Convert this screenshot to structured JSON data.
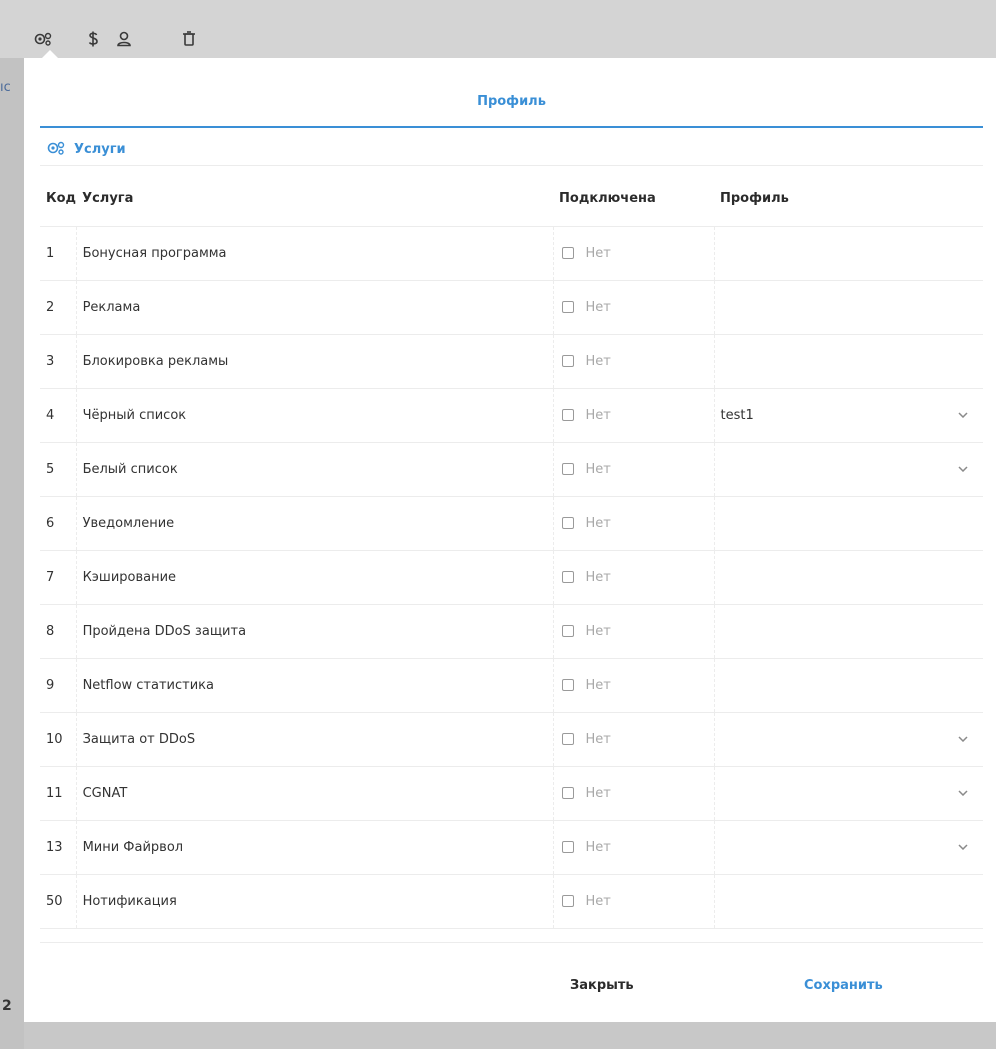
{
  "background": {
    "toolbar_icons": [
      "services-icon",
      "dollar-icon",
      "user-icon",
      "trash-icon"
    ],
    "side_fragment_top": "ıc",
    "side_fragment_bottom": "2"
  },
  "modal": {
    "tab_label": "Профиль",
    "section_label": "Услуги",
    "columns": {
      "code": "Код",
      "service": "Услуга",
      "connected": "Подключена",
      "profile": "Профиль"
    },
    "rows": [
      {
        "code": "1",
        "name": "Бонусная программа",
        "connected": "Нет",
        "profile": "",
        "has_dropdown": false
      },
      {
        "code": "2",
        "name": "Реклама",
        "connected": "Нет",
        "profile": "",
        "has_dropdown": false
      },
      {
        "code": "3",
        "name": "Блокировка рекламы",
        "connected": "Нет",
        "profile": "",
        "has_dropdown": false
      },
      {
        "code": "4",
        "name": "Чёрный список",
        "connected": "Нет",
        "profile": "test1",
        "has_dropdown": true
      },
      {
        "code": "5",
        "name": "Белый список",
        "connected": "Нет",
        "profile": "",
        "has_dropdown": true
      },
      {
        "code": "6",
        "name": "Уведомление",
        "connected": "Нет",
        "profile": "",
        "has_dropdown": false
      },
      {
        "code": "7",
        "name": "Кэширование",
        "connected": "Нет",
        "profile": "",
        "has_dropdown": false
      },
      {
        "code": "8",
        "name": "Пройдена DDoS защита",
        "connected": "Нет",
        "profile": "",
        "has_dropdown": false
      },
      {
        "code": "9",
        "name": "Netflow статистика",
        "connected": "Нет",
        "profile": "",
        "has_dropdown": false
      },
      {
        "code": "10",
        "name": "Защита от DDoS",
        "connected": "Нет",
        "profile": "",
        "has_dropdown": true
      },
      {
        "code": "11",
        "name": "CGNAT",
        "connected": "Нет",
        "profile": "",
        "has_dropdown": true
      },
      {
        "code": "13",
        "name": "Мини Файрвол",
        "connected": "Нет",
        "profile": "",
        "has_dropdown": true
      },
      {
        "code": "50",
        "name": "Нотификация",
        "connected": "Нет",
        "profile": "",
        "has_dropdown": false
      }
    ],
    "buttons": {
      "close": "Закрыть",
      "save": "Сохранить"
    }
  },
  "colors": {
    "accent": "#3a8fd6",
    "muted": "#a8a8a8"
  }
}
